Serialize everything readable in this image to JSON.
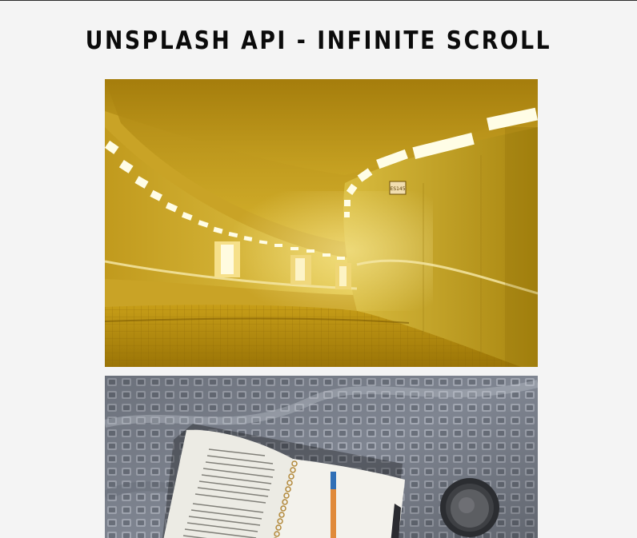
{
  "header": {
    "title": "UNSPLASH API - INFINITE SCROLL"
  },
  "gallery": {
    "photos": [
      {
        "subject": "yellow-lit-underground-tunnel",
        "sign_text": "ES145"
      },
      {
        "subject": "open-notebook-with-pen-and-coffee"
      }
    ]
  },
  "colors": {
    "background": "#f4f4f4",
    "title": "#0b0b0b"
  }
}
